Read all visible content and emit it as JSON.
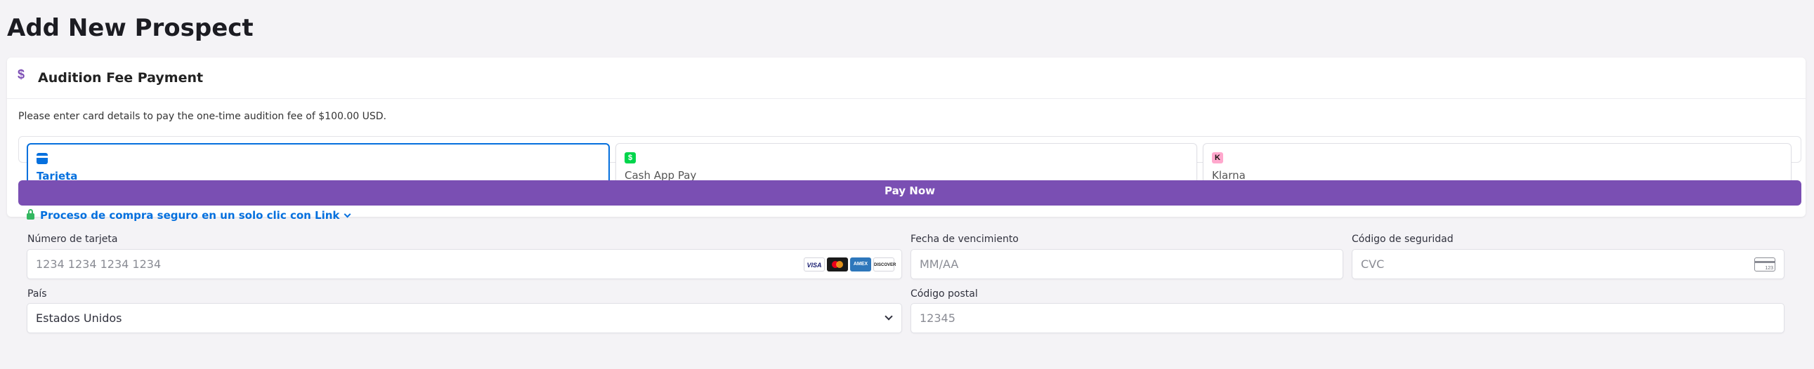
{
  "page": {
    "title": "Add New Prospect"
  },
  "card": {
    "icon": "dollar-icon",
    "title": "Audition Fee Payment",
    "description": "Please enter card details to pay the one-time audition fee of $100.00 USD."
  },
  "payment_methods": [
    {
      "label": "Tarjeta",
      "icon": "credit-card-icon",
      "selected": true
    },
    {
      "label": "Cash App Pay",
      "icon": "cash-app-icon",
      "icon_glyph": "$",
      "selected": false
    },
    {
      "label": "Klarna",
      "icon": "klarna-icon",
      "icon_glyph": "K",
      "selected": false
    }
  ],
  "pay_button": {
    "label": "Pay Now"
  },
  "link": {
    "label": "Proceso de compra seguro en un solo clic con Link"
  },
  "form": {
    "card_number": {
      "label": "Número de tarjeta",
      "placeholder": "1234 1234 1234 1234",
      "brands": [
        "VISA",
        "MC",
        "AMEX",
        "DISCOVER"
      ]
    },
    "expiry": {
      "label": "Fecha de vencimiento",
      "placeholder": "MM/AA"
    },
    "cvc": {
      "label": "Código de seguridad",
      "placeholder": "CVC",
      "icon_text": "123"
    },
    "country": {
      "label": "País",
      "value": "Estados Unidos"
    },
    "postal": {
      "label": "Código postal",
      "placeholder": "12345"
    }
  },
  "colors": {
    "accent": "#0570de",
    "button": "#7a4fb3",
    "background": "#f4f3f6",
    "cash_app": "#00d54b",
    "klarna": "#ffa8cd",
    "lock": "#33b760"
  }
}
